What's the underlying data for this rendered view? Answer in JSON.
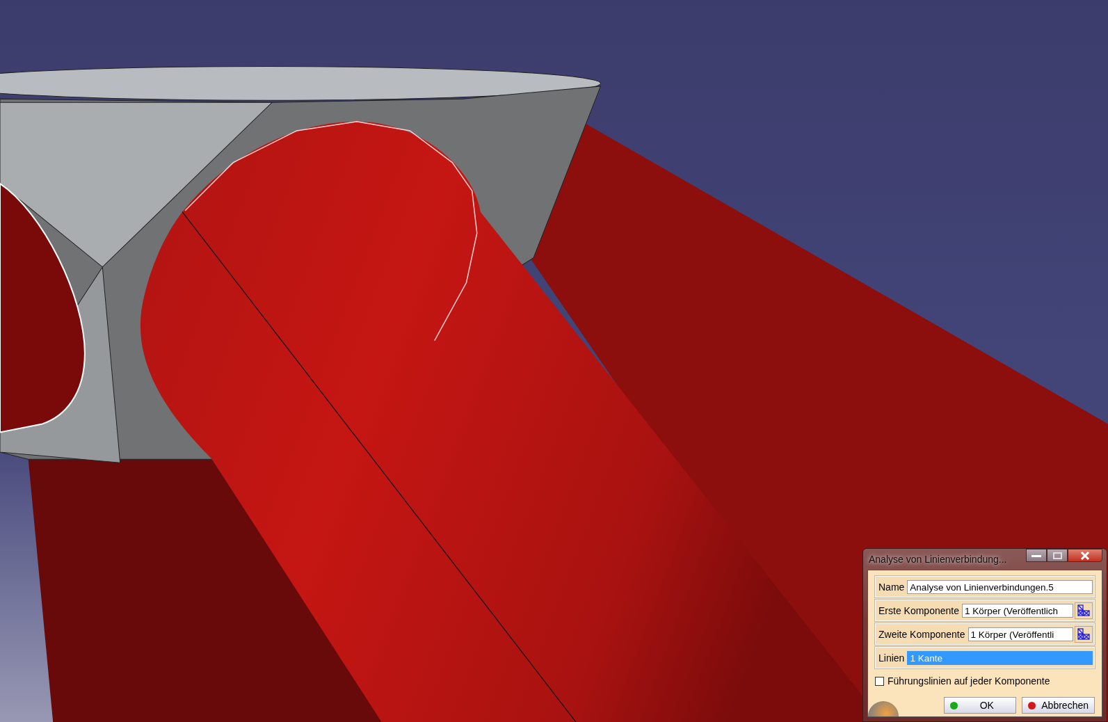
{
  "dialog": {
    "title": "Analyse von Linienverbindung...",
    "fields": [
      {
        "label": "Name",
        "value": "Analyse von Linienverbindungen.5",
        "kind": "text",
        "selected": false
      },
      {
        "label": "Erste Komponente",
        "value": "1 Körper (Veröffentlich",
        "kind": "picker",
        "selected": false
      },
      {
        "label": "Zweite Komponente",
        "value": "1 Körper (Veröffentli",
        "kind": "picker",
        "selected": false
      },
      {
        "label": "Linien",
        "value": "1 Kante",
        "kind": "text",
        "selected": true
      }
    ],
    "checkbox": {
      "label": "Führungslinien auf jeder Komponente",
      "checked": false
    },
    "buttons": [
      {
        "label": "OK",
        "color": "#1aa81a"
      },
      {
        "label": "Abbrechen",
        "color": "#d01818"
      }
    ]
  }
}
